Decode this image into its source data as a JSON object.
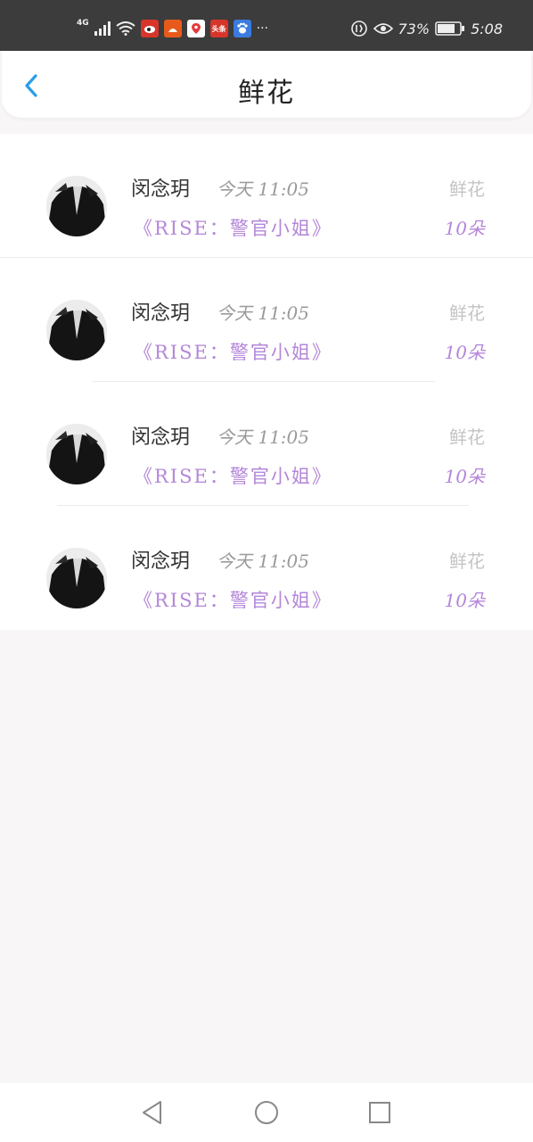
{
  "status_bar": {
    "network": "4G",
    "battery_percent": "73%",
    "time": "5:08",
    "overflow": "···",
    "apps": [
      {
        "icon": "weibo-app-icon",
        "label": "",
        "color": "#d8352a"
      },
      {
        "icon": "taobao-app-icon",
        "label": "",
        "color": "#e85a1c"
      },
      {
        "icon": "location-app-icon",
        "label": "",
        "color": "#ffffff"
      },
      {
        "icon": "toutiao-app-icon",
        "label": "头条",
        "color": "#d8352a"
      },
      {
        "icon": "baidu-app-icon",
        "label": "",
        "color": "#3b7be0"
      }
    ]
  },
  "header": {
    "title": "鲜花",
    "back_icon": "chevron-left-icon"
  },
  "list": [
    {
      "name": "闵念玥",
      "time": "今天  11:05",
      "book": "《RISE：警官小姐》",
      "type": "鲜花",
      "count": "10朵"
    },
    {
      "name": "闵念玥",
      "time": "今天  11:05",
      "book": "《RISE：警官小姐》",
      "type": "鲜花",
      "count": "10朵"
    },
    {
      "name": "闵念玥",
      "time": "今天  11:05",
      "book": "《RISE：警官小姐》",
      "type": "鲜花",
      "count": "10朵"
    },
    {
      "name": "闵念玥",
      "time": "今天  11:05",
      "book": "《RISE：警官小姐》",
      "type": "鲜花",
      "count": "10朵"
    }
  ],
  "colors": {
    "accent": "#2a9ee8",
    "purple_text": "#b486d8",
    "background": "#f8f6f7"
  }
}
